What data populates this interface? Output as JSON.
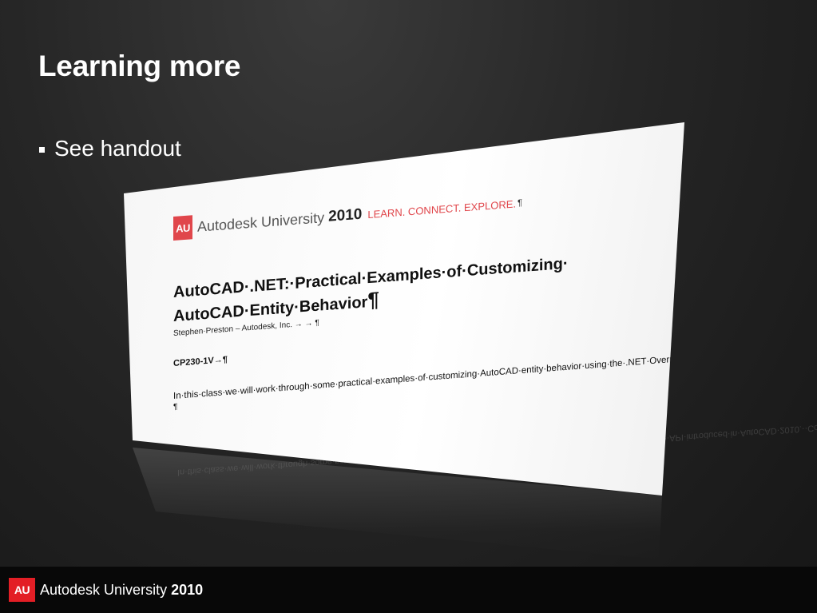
{
  "slide": {
    "title": "Learning more",
    "bullets": [
      "See handout"
    ]
  },
  "handout": {
    "logo_text": "AU",
    "brand": "Autodesk University",
    "brand_year": "2010",
    "tagline": "LEARN. CONNECT. EXPLORE.",
    "pilcrow": "¶",
    "title_line1": "AutoCAD·.NET:·Practical·Examples·of·Customizing·",
    "title_line2": "AutoCAD·Entity·Behavior",
    "byline": "Stephen·Preston – Autodesk, Inc.  →    →  ¶",
    "class_code": "CP230-1V→¶",
    "abstract": "In·this·class·we·will·work·through·some·practical·examples·of·customizing·AutoCAD·entity·behavior·using·the·.NET·Overrule·API·introduced·in·AutoCAD·2010.··Coding·examples·will·be·presented·in·VB.NET,·but·the·concepts·demonstrated·apply·to·all·other·.NET·programming·languages.↵",
    "abstract_end_mark": "¶"
  },
  "footer": {
    "logo_text": "AU",
    "brand": "Autodesk University",
    "year": "2010"
  },
  "colors": {
    "background": "#262626",
    "au_red": "#e31e25",
    "text": "#ffffff"
  }
}
